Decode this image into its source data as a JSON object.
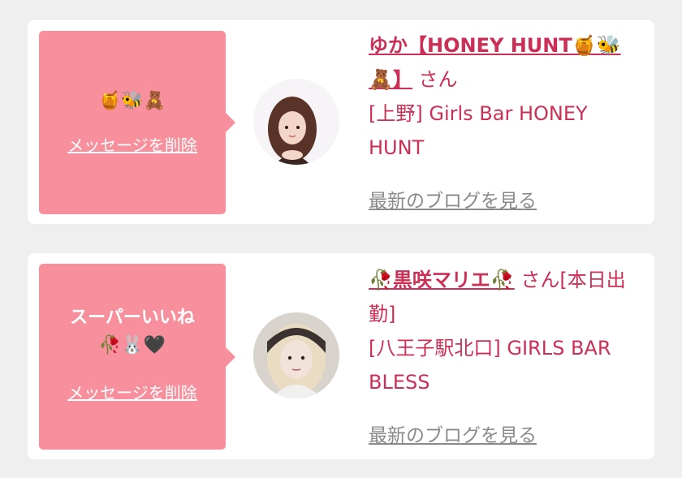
{
  "cards": [
    {
      "bubble_text": "🍯🐝🧸",
      "delete_label": "メッセージを削除",
      "name": "ゆか【HONEY HUNT🍯🐝🧸】",
      "suffix": " さん",
      "shop": "[上野] Girls Bar HONEY HUNT",
      "blog_label": "最新のブログを見る"
    },
    {
      "bubble_text_line1": "スーパーいいね",
      "bubble_text_line2": "🥀🐰🖤",
      "delete_label": "メッセージを削除",
      "name": "🥀黒咲マリエ🥀",
      "suffix": " さん[本日出勤]",
      "shop": "[八王子駅北口] GIRLS BAR BLESS",
      "blog_label": "最新のブログを見る"
    }
  ]
}
